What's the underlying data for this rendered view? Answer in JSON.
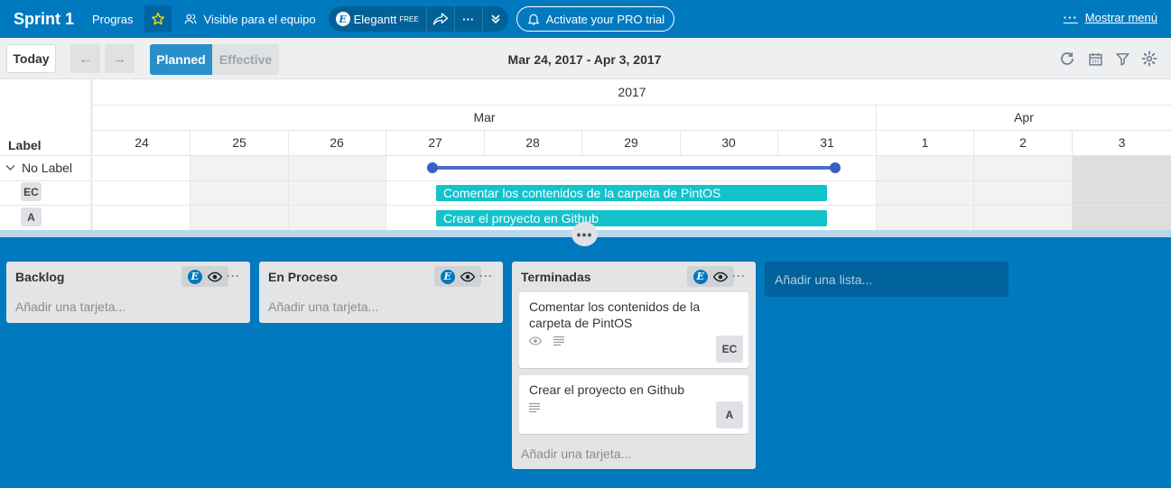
{
  "header": {
    "board_title": "Sprint 1",
    "team_name": "Progras",
    "visibility_label": "Visible para el equipo",
    "extension_name": "Elegantt",
    "extension_tier": "FREE",
    "extension_logo_letter": "E",
    "pro_trial_label": "Activate your PRO trial",
    "menu_dots": "···",
    "menu_label": "Mostrar menú",
    "star_color": "#f2d600"
  },
  "gantt_toolbar": {
    "today_label": "Today",
    "prev_arrow": "←",
    "next_arrow": "→",
    "planned_label": "Planned",
    "effective_label": "Effective",
    "date_range": "Mar 24, 2017 - Apr 3, 2017"
  },
  "timeline": {
    "year": "2017",
    "months": [
      "Mar",
      "Apr"
    ],
    "days": [
      "24",
      "25",
      "26",
      "27",
      "28",
      "29",
      "30",
      "31",
      "1",
      "2",
      "3"
    ],
    "label_column_header": "Label"
  },
  "gantt_rows": {
    "group_label": "No Label",
    "rows": [
      {
        "avatar": "EC",
        "task": "Comentar los contenidos de la carpeta de PintOS"
      },
      {
        "avatar": "A",
        "task": "Crear el proyecto en Github"
      }
    ],
    "bar_color": "#13c2cb",
    "summary_color": "#4b6fc8"
  },
  "splitter_label": "•••",
  "lists": [
    {
      "title": "Backlog",
      "add_card": "Añadir una tarjeta...",
      "cards": []
    },
    {
      "title": "En Proceso",
      "add_card": "Añadir una tarjeta...",
      "cards": []
    },
    {
      "title": "Terminadas",
      "add_card": "Añadir una tarjeta...",
      "cards": [
        {
          "title": "Comentar los contenidos de la carpeta de PintOS",
          "member": "EC",
          "icons": [
            "eye-icon",
            "description-icon"
          ]
        },
        {
          "title": "Crear el proyecto en Github",
          "member": "A",
          "icons": [
            "description-icon"
          ]
        }
      ]
    }
  ],
  "list_more": "···",
  "add_list_label": "Añadir una lista...",
  "colors": {
    "board_bg": "#0079bf",
    "accent": "#298fca",
    "list_bg": "#e2e4e6"
  }
}
